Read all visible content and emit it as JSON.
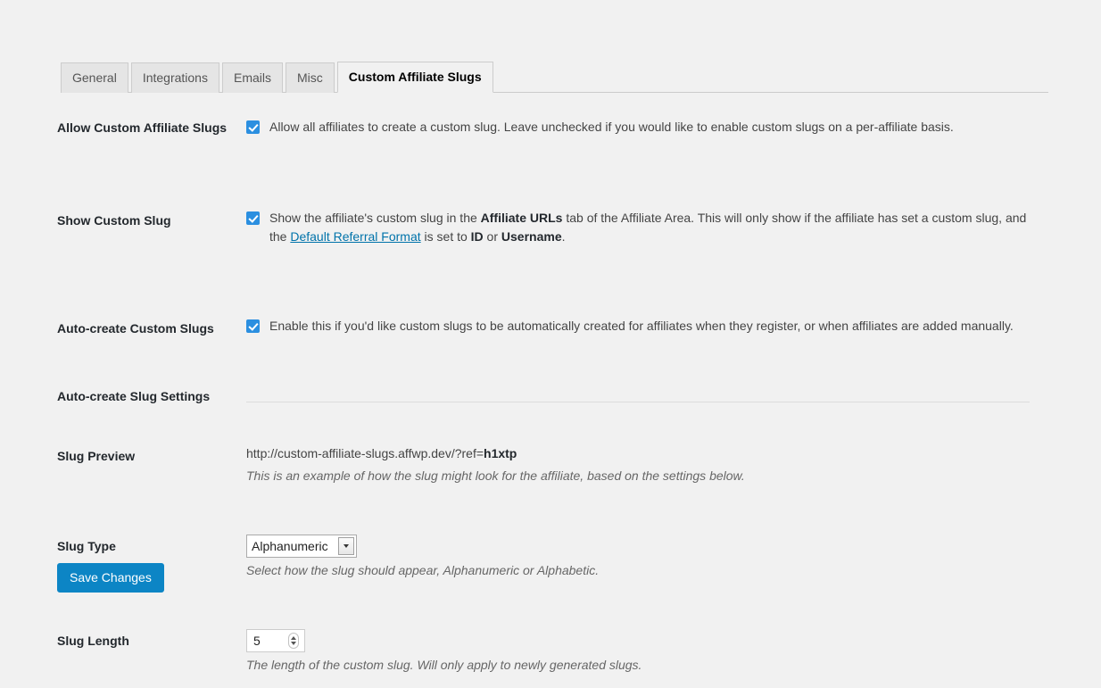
{
  "tabs": [
    {
      "label": "General",
      "active": false
    },
    {
      "label": "Integrations",
      "active": false
    },
    {
      "label": "Emails",
      "active": false
    },
    {
      "label": "Misc",
      "active": false
    },
    {
      "label": "Custom Affiliate Slugs",
      "active": true
    }
  ],
  "settings": {
    "allow_custom_slugs": {
      "label": "Allow Custom Affiliate Slugs",
      "checked": true,
      "description": "Allow all affiliates to create a custom slug. Leave unchecked if you would like to enable custom slugs on a per-affiliate basis."
    },
    "show_custom_slug": {
      "label": "Show Custom Slug",
      "checked": true,
      "desc_part1": "Show the affiliate's custom slug in the ",
      "desc_bold1": "Affiliate URLs",
      "desc_part2": " tab of the Affiliate Area. This will only show if the affiliate has set a custom slug, and the ",
      "desc_link": "Default Referral Format",
      "desc_part3": " is set to ",
      "desc_bold2": "ID",
      "desc_part4": " or ",
      "desc_bold3": "Username",
      "desc_part5": "."
    },
    "auto_create": {
      "label": "Auto-create Custom Slugs",
      "checked": true,
      "description": "Enable this if you'd like custom slugs to be automatically created for affiliates when they register, or when affiliates are added manually."
    },
    "section_header": {
      "label": "Auto-create Slug Settings"
    },
    "slug_preview": {
      "label": "Slug Preview",
      "url_base": "http://custom-affiliate-slugs.affwp.dev/?ref=",
      "url_slug": "h1xtp",
      "hint": "This is an example of how the slug might look for the affiliate, based on the settings below."
    },
    "slug_type": {
      "label": "Slug Type",
      "value": "Alphanumeric",
      "options": [
        "Alphanumeric",
        "Alphabetic"
      ],
      "hint": "Select how the slug should appear, Alphanumeric or Alphabetic."
    },
    "slug_length": {
      "label": "Slug Length",
      "value": "5",
      "hint": "The length of the custom slug. Will only apply to newly generated slugs."
    }
  },
  "submit": {
    "save_label": "Save Changes"
  },
  "colors": {
    "accent": "#0c85c5",
    "checkbox": "#2b8fe0",
    "link": "#0073aa",
    "background": "#f1f1f1"
  }
}
